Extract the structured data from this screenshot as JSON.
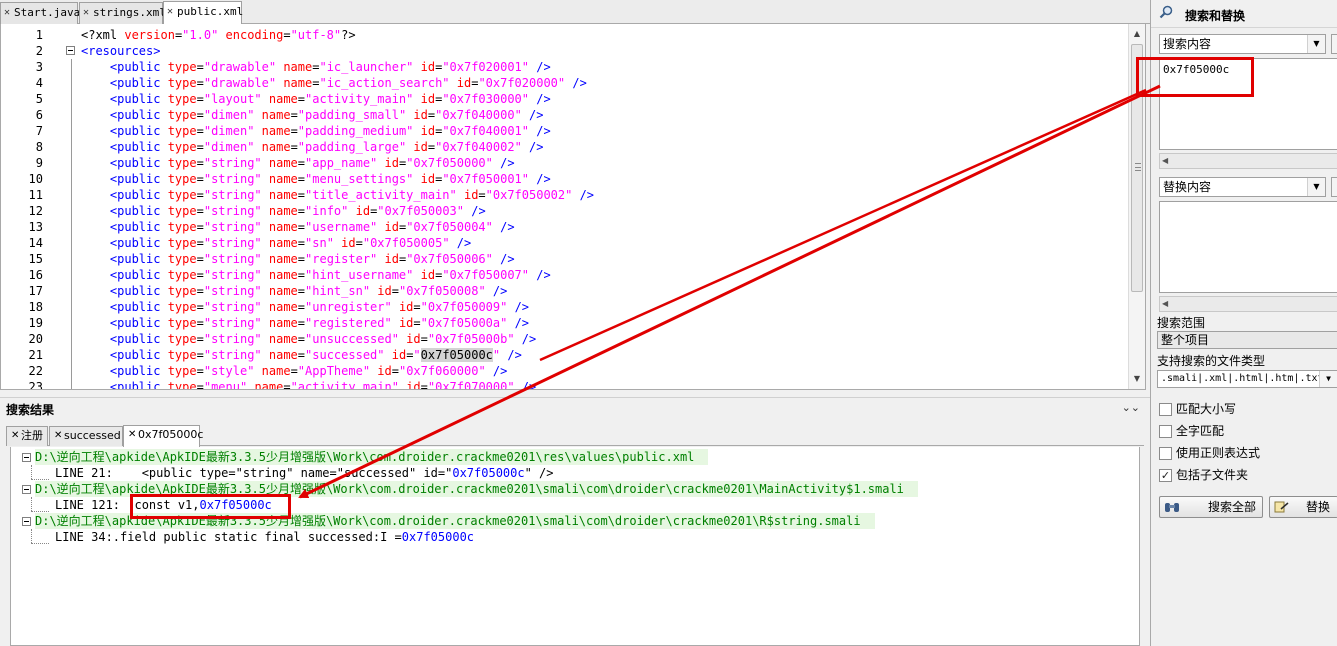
{
  "editor_tabs": [
    "Start.java",
    "strings.xml",
    "public.xml"
  ],
  "code_lines": [
    {
      "n": "1",
      "t": [
        [
          "plain",
          "<?xml "
        ],
        [
          "attr",
          "version"
        ],
        [
          "plain",
          "="
        ],
        [
          "val",
          "\"1.0\""
        ],
        [
          "plain",
          " "
        ],
        [
          "attr",
          "encoding"
        ],
        [
          "plain",
          "="
        ],
        [
          "val",
          "\"utf-8\""
        ],
        [
          "plain",
          "?>"
        ]
      ]
    },
    {
      "n": "2",
      "t": [
        [
          "tag",
          "<resources>"
        ]
      ]
    },
    {
      "n": "3",
      "t": [
        [
          "tag",
          "    <public "
        ],
        [
          "attr",
          "type"
        ],
        [
          "plain",
          "="
        ],
        [
          "val",
          "\"drawable\""
        ],
        [
          "plain",
          " "
        ],
        [
          "attr",
          "name"
        ],
        [
          "plain",
          "="
        ],
        [
          "val",
          "\"ic_launcher\""
        ],
        [
          "plain",
          " "
        ],
        [
          "attr",
          "id"
        ],
        [
          "plain",
          "="
        ],
        [
          "val",
          "\"0x7f020001\""
        ],
        [
          "tag",
          " />"
        ]
      ]
    },
    {
      "n": "4",
      "t": [
        [
          "tag",
          "    <public "
        ],
        [
          "attr",
          "type"
        ],
        [
          "plain",
          "="
        ],
        [
          "val",
          "\"drawable\""
        ],
        [
          "plain",
          " "
        ],
        [
          "attr",
          "name"
        ],
        [
          "plain",
          "="
        ],
        [
          "val",
          "\"ic_action_search\""
        ],
        [
          "plain",
          " "
        ],
        [
          "attr",
          "id"
        ],
        [
          "plain",
          "="
        ],
        [
          "val",
          "\"0x7f020000\""
        ],
        [
          "tag",
          " />"
        ]
      ]
    },
    {
      "n": "5",
      "t": [
        [
          "tag",
          "    <public "
        ],
        [
          "attr",
          "type"
        ],
        [
          "plain",
          "="
        ],
        [
          "val",
          "\"layout\""
        ],
        [
          "plain",
          " "
        ],
        [
          "attr",
          "name"
        ],
        [
          "plain",
          "="
        ],
        [
          "val",
          "\"activity_main\""
        ],
        [
          "plain",
          " "
        ],
        [
          "attr",
          "id"
        ],
        [
          "plain",
          "="
        ],
        [
          "val",
          "\"0x7f030000\""
        ],
        [
          "tag",
          " />"
        ]
      ]
    },
    {
      "n": "6",
      "t": [
        [
          "tag",
          "    <public "
        ],
        [
          "attr",
          "type"
        ],
        [
          "plain",
          "="
        ],
        [
          "val",
          "\"dimen\""
        ],
        [
          "plain",
          " "
        ],
        [
          "attr",
          "name"
        ],
        [
          "plain",
          "="
        ],
        [
          "val",
          "\"padding_small\""
        ],
        [
          "plain",
          " "
        ],
        [
          "attr",
          "id"
        ],
        [
          "plain",
          "="
        ],
        [
          "val",
          "\"0x7f040000\""
        ],
        [
          "tag",
          " />"
        ]
      ]
    },
    {
      "n": "7",
      "t": [
        [
          "tag",
          "    <public "
        ],
        [
          "attr",
          "type"
        ],
        [
          "plain",
          "="
        ],
        [
          "val",
          "\"dimen\""
        ],
        [
          "plain",
          " "
        ],
        [
          "attr",
          "name"
        ],
        [
          "plain",
          "="
        ],
        [
          "val",
          "\"padding_medium\""
        ],
        [
          "plain",
          " "
        ],
        [
          "attr",
          "id"
        ],
        [
          "plain",
          "="
        ],
        [
          "val",
          "\"0x7f040001\""
        ],
        [
          "tag",
          " />"
        ]
      ]
    },
    {
      "n": "8",
      "t": [
        [
          "tag",
          "    <public "
        ],
        [
          "attr",
          "type"
        ],
        [
          "plain",
          "="
        ],
        [
          "val",
          "\"dimen\""
        ],
        [
          "plain",
          " "
        ],
        [
          "attr",
          "name"
        ],
        [
          "plain",
          "="
        ],
        [
          "val",
          "\"padding_large\""
        ],
        [
          "plain",
          " "
        ],
        [
          "attr",
          "id"
        ],
        [
          "plain",
          "="
        ],
        [
          "val",
          "\"0x7f040002\""
        ],
        [
          "tag",
          " />"
        ]
      ]
    },
    {
      "n": "9",
      "t": [
        [
          "tag",
          "    <public "
        ],
        [
          "attr",
          "type"
        ],
        [
          "plain",
          "="
        ],
        [
          "val",
          "\"string\""
        ],
        [
          "plain",
          " "
        ],
        [
          "attr",
          "name"
        ],
        [
          "plain",
          "="
        ],
        [
          "val",
          "\"app_name\""
        ],
        [
          "plain",
          " "
        ],
        [
          "attr",
          "id"
        ],
        [
          "plain",
          "="
        ],
        [
          "val",
          "\"0x7f050000\""
        ],
        [
          "tag",
          " />"
        ]
      ]
    },
    {
      "n": "10",
      "t": [
        [
          "tag",
          "    <public "
        ],
        [
          "attr",
          "type"
        ],
        [
          "plain",
          "="
        ],
        [
          "val",
          "\"string\""
        ],
        [
          "plain",
          " "
        ],
        [
          "attr",
          "name"
        ],
        [
          "plain",
          "="
        ],
        [
          "val",
          "\"menu_settings\""
        ],
        [
          "plain",
          " "
        ],
        [
          "attr",
          "id"
        ],
        [
          "plain",
          "="
        ],
        [
          "val",
          "\"0x7f050001\""
        ],
        [
          "tag",
          " />"
        ]
      ]
    },
    {
      "n": "11",
      "t": [
        [
          "tag",
          "    <public "
        ],
        [
          "attr",
          "type"
        ],
        [
          "plain",
          "="
        ],
        [
          "val",
          "\"string\""
        ],
        [
          "plain",
          " "
        ],
        [
          "attr",
          "name"
        ],
        [
          "plain",
          "="
        ],
        [
          "val",
          "\"title_activity_main\""
        ],
        [
          "plain",
          " "
        ],
        [
          "attr",
          "id"
        ],
        [
          "plain",
          "="
        ],
        [
          "val",
          "\"0x7f050002\""
        ],
        [
          "tag",
          " />"
        ]
      ]
    },
    {
      "n": "12",
      "t": [
        [
          "tag",
          "    <public "
        ],
        [
          "attr",
          "type"
        ],
        [
          "plain",
          "="
        ],
        [
          "val",
          "\"string\""
        ],
        [
          "plain",
          " "
        ],
        [
          "attr",
          "name"
        ],
        [
          "plain",
          "="
        ],
        [
          "val",
          "\"info\""
        ],
        [
          "plain",
          " "
        ],
        [
          "attr",
          "id"
        ],
        [
          "plain",
          "="
        ],
        [
          "val",
          "\"0x7f050003\""
        ],
        [
          "tag",
          " />"
        ]
      ]
    },
    {
      "n": "13",
      "t": [
        [
          "tag",
          "    <public "
        ],
        [
          "attr",
          "type"
        ],
        [
          "plain",
          "="
        ],
        [
          "val",
          "\"string\""
        ],
        [
          "plain",
          " "
        ],
        [
          "attr",
          "name"
        ],
        [
          "plain",
          "="
        ],
        [
          "val",
          "\"username\""
        ],
        [
          "plain",
          " "
        ],
        [
          "attr",
          "id"
        ],
        [
          "plain",
          "="
        ],
        [
          "val",
          "\"0x7f050004\""
        ],
        [
          "tag",
          " />"
        ]
      ]
    },
    {
      "n": "14",
      "t": [
        [
          "tag",
          "    <public "
        ],
        [
          "attr",
          "type"
        ],
        [
          "plain",
          "="
        ],
        [
          "val",
          "\"string\""
        ],
        [
          "plain",
          " "
        ],
        [
          "attr",
          "name"
        ],
        [
          "plain",
          "="
        ],
        [
          "val",
          "\"sn\""
        ],
        [
          "plain",
          " "
        ],
        [
          "attr",
          "id"
        ],
        [
          "plain",
          "="
        ],
        [
          "val",
          "\"0x7f050005\""
        ],
        [
          "tag",
          " />"
        ]
      ]
    },
    {
      "n": "15",
      "t": [
        [
          "tag",
          "    <public "
        ],
        [
          "attr",
          "type"
        ],
        [
          "plain",
          "="
        ],
        [
          "val",
          "\"string\""
        ],
        [
          "plain",
          " "
        ],
        [
          "attr",
          "name"
        ],
        [
          "plain",
          "="
        ],
        [
          "val",
          "\"register\""
        ],
        [
          "plain",
          " "
        ],
        [
          "attr",
          "id"
        ],
        [
          "plain",
          "="
        ],
        [
          "val",
          "\"0x7f050006\""
        ],
        [
          "tag",
          " />"
        ]
      ]
    },
    {
      "n": "16",
      "t": [
        [
          "tag",
          "    <public "
        ],
        [
          "attr",
          "type"
        ],
        [
          "plain",
          "="
        ],
        [
          "val",
          "\"string\""
        ],
        [
          "plain",
          " "
        ],
        [
          "attr",
          "name"
        ],
        [
          "plain",
          "="
        ],
        [
          "val",
          "\"hint_username\""
        ],
        [
          "plain",
          " "
        ],
        [
          "attr",
          "id"
        ],
        [
          "plain",
          "="
        ],
        [
          "val",
          "\"0x7f050007\""
        ],
        [
          "tag",
          " />"
        ]
      ]
    },
    {
      "n": "17",
      "t": [
        [
          "tag",
          "    <public "
        ],
        [
          "attr",
          "type"
        ],
        [
          "plain",
          "="
        ],
        [
          "val",
          "\"string\""
        ],
        [
          "plain",
          " "
        ],
        [
          "attr",
          "name"
        ],
        [
          "plain",
          "="
        ],
        [
          "val",
          "\"hint_sn\""
        ],
        [
          "plain",
          " "
        ],
        [
          "attr",
          "id"
        ],
        [
          "plain",
          "="
        ],
        [
          "val",
          "\"0x7f050008\""
        ],
        [
          "tag",
          " />"
        ]
      ]
    },
    {
      "n": "18",
      "t": [
        [
          "tag",
          "    <public "
        ],
        [
          "attr",
          "type"
        ],
        [
          "plain",
          "="
        ],
        [
          "val",
          "\"string\""
        ],
        [
          "plain",
          " "
        ],
        [
          "attr",
          "name"
        ],
        [
          "plain",
          "="
        ],
        [
          "val",
          "\"unregister\""
        ],
        [
          "plain",
          " "
        ],
        [
          "attr",
          "id"
        ],
        [
          "plain",
          "="
        ],
        [
          "val",
          "\"0x7f050009\""
        ],
        [
          "tag",
          " />"
        ]
      ]
    },
    {
      "n": "19",
      "t": [
        [
          "tag",
          "    <public "
        ],
        [
          "attr",
          "type"
        ],
        [
          "plain",
          "="
        ],
        [
          "val",
          "\"string\""
        ],
        [
          "plain",
          " "
        ],
        [
          "attr",
          "name"
        ],
        [
          "plain",
          "="
        ],
        [
          "val",
          "\"registered\""
        ],
        [
          "plain",
          " "
        ],
        [
          "attr",
          "id"
        ],
        [
          "plain",
          "="
        ],
        [
          "val",
          "\"0x7f05000a\""
        ],
        [
          "tag",
          " />"
        ]
      ]
    },
    {
      "n": "20",
      "t": [
        [
          "tag",
          "    <public "
        ],
        [
          "attr",
          "type"
        ],
        [
          "plain",
          "="
        ],
        [
          "val",
          "\"string\""
        ],
        [
          "plain",
          " "
        ],
        [
          "attr",
          "name"
        ],
        [
          "plain",
          "="
        ],
        [
          "val",
          "\"unsuccessed\""
        ],
        [
          "plain",
          " "
        ],
        [
          "attr",
          "id"
        ],
        [
          "plain",
          "="
        ],
        [
          "val",
          "\"0x7f05000b\""
        ],
        [
          "tag",
          " />"
        ]
      ]
    },
    {
      "n": "21",
      "t": [
        [
          "tag",
          "    <public "
        ],
        [
          "attr",
          "type"
        ],
        [
          "plain",
          "="
        ],
        [
          "val",
          "\"string\""
        ],
        [
          "plain",
          " "
        ],
        [
          "attr",
          "name"
        ],
        [
          "plain",
          "="
        ],
        [
          "val",
          "\"successed\""
        ],
        [
          "plain",
          " "
        ],
        [
          "attr",
          "id"
        ],
        [
          "plain",
          "="
        ],
        [
          "val",
          "\""
        ],
        [
          "hl",
          "0x7f05000c"
        ],
        [
          "val",
          "\""
        ],
        [
          "tag",
          " />"
        ]
      ]
    },
    {
      "n": "22",
      "t": [
        [
          "tag",
          "    <public "
        ],
        [
          "attr",
          "type"
        ],
        [
          "plain",
          "="
        ],
        [
          "val",
          "\"style\""
        ],
        [
          "plain",
          " "
        ],
        [
          "attr",
          "name"
        ],
        [
          "plain",
          "="
        ],
        [
          "val",
          "\"AppTheme\""
        ],
        [
          "plain",
          " "
        ],
        [
          "attr",
          "id"
        ],
        [
          "plain",
          "="
        ],
        [
          "val",
          "\"0x7f060000\""
        ],
        [
          "tag",
          " />"
        ]
      ]
    },
    {
      "n": "23",
      "t": [
        [
          "tag",
          "    <public "
        ],
        [
          "attr",
          "type"
        ],
        [
          "plain",
          "="
        ],
        [
          "val",
          "\"menu\""
        ],
        [
          "plain",
          " "
        ],
        [
          "attr",
          "name"
        ],
        [
          "plain",
          "="
        ],
        [
          "val",
          "\"activity_main\""
        ],
        [
          "plain",
          " "
        ],
        [
          "attr",
          "id"
        ],
        [
          "plain",
          "="
        ],
        [
          "val",
          "\"0x7f070000\""
        ],
        [
          "tag",
          " />"
        ]
      ]
    }
  ],
  "results": {
    "title": "搜索结果",
    "tabs": [
      "注册",
      "successed",
      "0x7f05000c"
    ],
    "file1": "D:\\逆向工程\\apkide\\ApkIDE最新3.3.5少月增强版\\Work\\com.droider.crackme0201\\res\\values\\public.xml",
    "line1_label": "LINE 21:",
    "line1_text": "    <public type=\"string\" name=\"successed\" id=\"",
    "line1_match": "0x7f05000c",
    "line1_tail": "\" />",
    "file2": "D:\\逆向工程\\apkide\\ApkIDE最新3.3.5少月增强版\\Work\\com.droider.crackme0201\\smali\\com\\droider\\crackme0201\\MainActivity$1.smali",
    "line2_label": "LINE 121:",
    "line2_text": "  const v1,",
    "line2_match": "0x7f05000c",
    "file3": "D:\\逆向工程\\apkide\\ApkIDE最新3.3.5少月增强版\\Work\\com.droider.crackme0201\\smali\\com\\droider\\crackme0201\\R$string.smali",
    "line3_label": "LINE 34:",
    "line3_text": ".field public static final successed:I =",
    "line3_match": "0x7f05000c"
  },
  "search_panel": {
    "title": "搜索和替换",
    "search_label": "搜索内容",
    "search_value": "0x7f05000c",
    "replace_label": "替换内容",
    "replace_value": "",
    "scope_label": "搜索范围",
    "scope_value": "整个项目",
    "filetypes_label": "支持搜索的文件类型",
    "filetypes_value": ".smali|.xml|.html|.htm|.txt",
    "options": [
      {
        "label": "匹配大小写",
        "checked": false
      },
      {
        "label": "全字匹配",
        "checked": false
      },
      {
        "label": "使用正则表达式",
        "checked": false
      },
      {
        "label": "包括子文件夹",
        "checked": true
      }
    ],
    "search_all_button": "搜索全部",
    "replace_button": "替换"
  },
  "colors": {
    "accent_red": "#e00000",
    "xml_tag": "#0000ff",
    "xml_attr": "#ff0000",
    "xml_value": "#ff00ff",
    "result_file": "#008000"
  }
}
